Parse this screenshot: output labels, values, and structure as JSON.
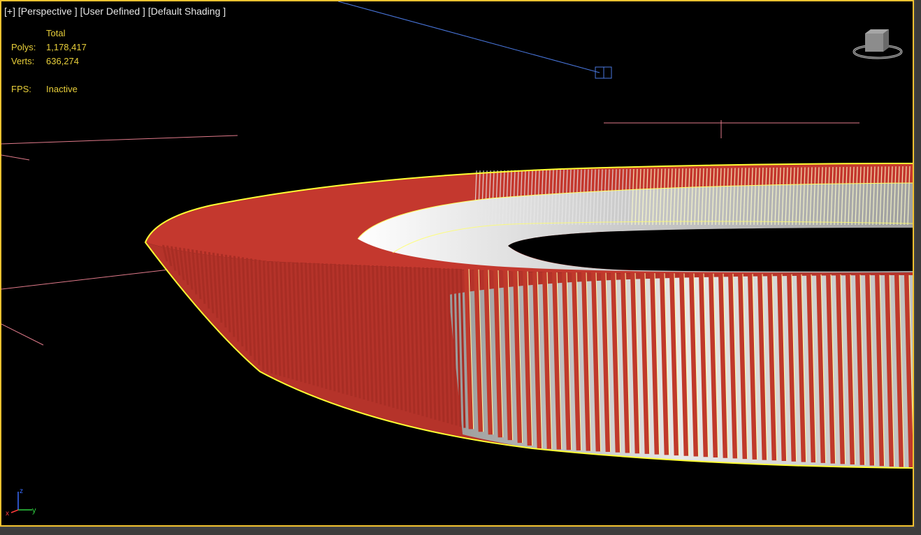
{
  "viewport": {
    "label_parts": [
      "[+]",
      "[Perspective ]",
      "[User Defined ]",
      "[Default Shading ]"
    ]
  },
  "stats": {
    "header": "Total",
    "polys_label": "Polys:",
    "polys_value": "1,178,417",
    "verts_label": "Verts:",
    "verts_value": "636,274",
    "fps_label": "FPS:",
    "fps_value": "Inactive"
  },
  "axis": {
    "x": "x",
    "y": "y",
    "z": "z"
  },
  "icons": {
    "viewcube": "viewcube-icon",
    "axis": "axis-tripod-icon",
    "camera_target": "camera-target-icon"
  },
  "colors": {
    "frame": "#f2c230",
    "background": "#000000",
    "stats_text": "#e8cf3a",
    "ring_red": "#c0392b",
    "ring_white": "#d9d9d9",
    "selection_outline": "#ffff33",
    "guide_pink": "#e07a8a",
    "camera_line": "#4a78e0"
  }
}
